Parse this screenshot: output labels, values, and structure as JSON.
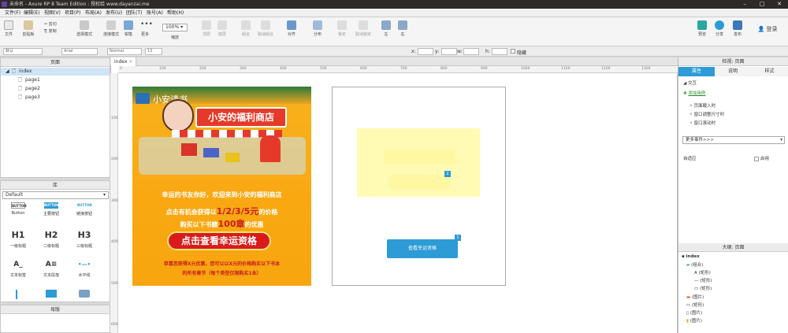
{
  "window": {
    "title": "未命名 - Axure RP 8 Team Edition : 授权给 www.dayanzai.me"
  },
  "menu": [
    "文件(F)",
    "编辑(E)",
    "视图(V)",
    "项目(P)",
    "布局(A)",
    "发布(U)",
    "团队(T)",
    "账号(A)",
    "帮助(H)"
  ],
  "toolbar": {
    "file": "文件",
    "clipboard": "剪贴板",
    "paste": "粘贴",
    "cut": "剪切",
    "copy": "复制",
    "select_mode": "选择模式",
    "connect": "连接模式",
    "crop": "钳笔",
    "more": "更多",
    "zoom": "100%",
    "zoom_label": "缩放",
    "top": "顶层",
    "bottom": "底层",
    "group": "组合",
    "ungroup": "取消组合",
    "align": "对齐",
    "distribute": "分布",
    "lock": "锁定",
    "unlock": "取消锁定",
    "left": "左",
    "right": "右",
    "preview": "预览",
    "share": "分享",
    "publish": "发布",
    "login": "登录"
  },
  "format": {
    "style": "默认",
    "font": "Arial",
    "weight": "Normal",
    "size": "13",
    "x_label": "x:",
    "y_label": "y:",
    "w_label": "w:",
    "h_label": "h:",
    "hidden": "隐藏"
  },
  "pages": {
    "header": "页面",
    "root": "index",
    "children": [
      "page1",
      "page2",
      "page3"
    ]
  },
  "library": {
    "header": "库",
    "select": "Default",
    "widgets": [
      {
        "icon": "BUTTON",
        "label": "Button"
      },
      {
        "icon": "BUTTON",
        "label": "主要按钮"
      },
      {
        "icon": "BUTTON",
        "label": "链接按钮"
      },
      {
        "icon": "H1",
        "label": "一级标题"
      },
      {
        "icon": "H2",
        "label": "二级标题"
      },
      {
        "icon": "H3",
        "label": "三级标题"
      },
      {
        "icon": "A_",
        "label": "文本标签"
      },
      {
        "icon": "A≡",
        "label": "文本段落"
      },
      {
        "icon": "•—•",
        "label": "水平线"
      }
    ]
  },
  "masters": {
    "header": "母版"
  },
  "canvas": {
    "tab": "index",
    "ruler_h": [
      "0",
      "100",
      "200",
      "300",
      "400",
      "500",
      "600",
      "700",
      "800",
      "900",
      "1000",
      "1100",
      "1200",
      "1300"
    ],
    "ruler_v": [
      "100",
      "200",
      "300",
      "400",
      "500",
      "600"
    ],
    "poster": {
      "brand": "小安读书",
      "shop_title": "小安的福利商店",
      "line1": "幸运的书友你好，欢迎来到小安的福利商店",
      "line2_pre": "点击有机会获得以",
      "line2_hl": "1/2/3/5元",
      "line2_post": "的价格",
      "line3_pre": "购买以下书籍",
      "line3_hl": "100章",
      "line3_post": "的优惠",
      "cta": "点击查看幸运资格",
      "note1": "恭喜您获得X元优惠，您可以以X元的价格购买以下书本",
      "note2": "的所有章节（每个类型仅限购买1本）"
    },
    "button_label": "查看幸运资格",
    "badge1": "1",
    "badge2": "2"
  },
  "right": {
    "header": "检视: 页面",
    "tabs": [
      "属性",
      "说明",
      "样式"
    ],
    "interaction": "交互",
    "add_case": "添加用例",
    "events": [
      "页面载入时",
      "窗口调整尺寸时",
      "窗口滚动时"
    ],
    "more_events": "更多事件>>>",
    "adaptive": "自适应",
    "enable": "启用",
    "outline_header": "大纲: 页面",
    "outline_root": "index",
    "outline_items": [
      "(组合)",
      "(矩形)",
      "(矩形)",
      "(矩形)",
      "(图片)",
      "(矩形)",
      "(图片)",
      "(图片)"
    ]
  },
  "colors": {
    "accent": "#2d9bd6",
    "poster_bg": "#f8b21c",
    "cta_red": "#d91b1b",
    "highlight_yellow": "#fffbb5"
  }
}
